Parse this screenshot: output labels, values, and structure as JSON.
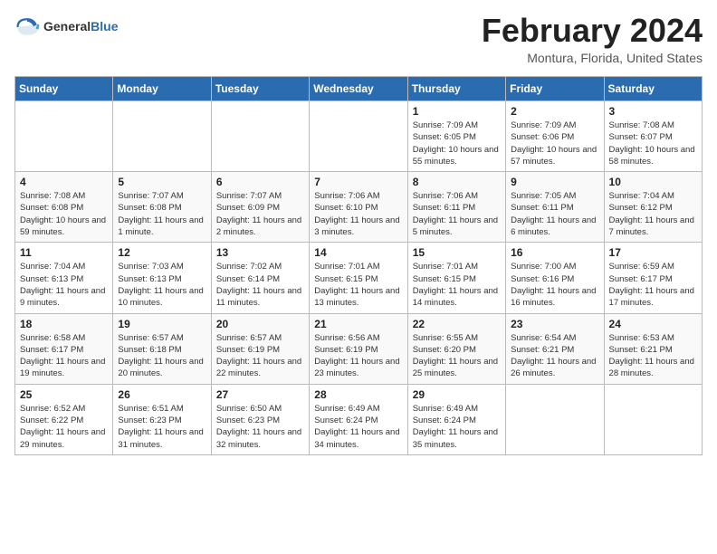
{
  "header": {
    "logo": {
      "general": "General",
      "blue": "Blue"
    },
    "title": "February 2024",
    "location": "Montura, Florida, United States"
  },
  "calendar": {
    "days_of_week": [
      "Sunday",
      "Monday",
      "Tuesday",
      "Wednesday",
      "Thursday",
      "Friday",
      "Saturday"
    ],
    "weeks": [
      [
        {
          "day": "",
          "info": ""
        },
        {
          "day": "",
          "info": ""
        },
        {
          "day": "",
          "info": ""
        },
        {
          "day": "",
          "info": ""
        },
        {
          "day": "1",
          "info": "Sunrise: 7:09 AM\nSunset: 6:05 PM\nDaylight: 10 hours\nand 55 minutes."
        },
        {
          "day": "2",
          "info": "Sunrise: 7:09 AM\nSunset: 6:06 PM\nDaylight: 10 hours\nand 57 minutes."
        },
        {
          "day": "3",
          "info": "Sunrise: 7:08 AM\nSunset: 6:07 PM\nDaylight: 10 hours\nand 58 minutes."
        }
      ],
      [
        {
          "day": "4",
          "info": "Sunrise: 7:08 AM\nSunset: 6:08 PM\nDaylight: 10 hours\nand 59 minutes."
        },
        {
          "day": "5",
          "info": "Sunrise: 7:07 AM\nSunset: 6:08 PM\nDaylight: 11 hours\nand 1 minute."
        },
        {
          "day": "6",
          "info": "Sunrise: 7:07 AM\nSunset: 6:09 PM\nDaylight: 11 hours\nand 2 minutes."
        },
        {
          "day": "7",
          "info": "Sunrise: 7:06 AM\nSunset: 6:10 PM\nDaylight: 11 hours\nand 3 minutes."
        },
        {
          "day": "8",
          "info": "Sunrise: 7:06 AM\nSunset: 6:11 PM\nDaylight: 11 hours\nand 5 minutes."
        },
        {
          "day": "9",
          "info": "Sunrise: 7:05 AM\nSunset: 6:11 PM\nDaylight: 11 hours\nand 6 minutes."
        },
        {
          "day": "10",
          "info": "Sunrise: 7:04 AM\nSunset: 6:12 PM\nDaylight: 11 hours\nand 7 minutes."
        }
      ],
      [
        {
          "day": "11",
          "info": "Sunrise: 7:04 AM\nSunset: 6:13 PM\nDaylight: 11 hours\nand 9 minutes."
        },
        {
          "day": "12",
          "info": "Sunrise: 7:03 AM\nSunset: 6:13 PM\nDaylight: 11 hours\nand 10 minutes."
        },
        {
          "day": "13",
          "info": "Sunrise: 7:02 AM\nSunset: 6:14 PM\nDaylight: 11 hours\nand 11 minutes."
        },
        {
          "day": "14",
          "info": "Sunrise: 7:01 AM\nSunset: 6:15 PM\nDaylight: 11 hours\nand 13 minutes."
        },
        {
          "day": "15",
          "info": "Sunrise: 7:01 AM\nSunset: 6:15 PM\nDaylight: 11 hours\nand 14 minutes."
        },
        {
          "day": "16",
          "info": "Sunrise: 7:00 AM\nSunset: 6:16 PM\nDaylight: 11 hours\nand 16 minutes."
        },
        {
          "day": "17",
          "info": "Sunrise: 6:59 AM\nSunset: 6:17 PM\nDaylight: 11 hours\nand 17 minutes."
        }
      ],
      [
        {
          "day": "18",
          "info": "Sunrise: 6:58 AM\nSunset: 6:17 PM\nDaylight: 11 hours\nand 19 minutes."
        },
        {
          "day": "19",
          "info": "Sunrise: 6:57 AM\nSunset: 6:18 PM\nDaylight: 11 hours\nand 20 minutes."
        },
        {
          "day": "20",
          "info": "Sunrise: 6:57 AM\nSunset: 6:19 PM\nDaylight: 11 hours\nand 22 minutes."
        },
        {
          "day": "21",
          "info": "Sunrise: 6:56 AM\nSunset: 6:19 PM\nDaylight: 11 hours\nand 23 minutes."
        },
        {
          "day": "22",
          "info": "Sunrise: 6:55 AM\nSunset: 6:20 PM\nDaylight: 11 hours\nand 25 minutes."
        },
        {
          "day": "23",
          "info": "Sunrise: 6:54 AM\nSunset: 6:21 PM\nDaylight: 11 hours\nand 26 minutes."
        },
        {
          "day": "24",
          "info": "Sunrise: 6:53 AM\nSunset: 6:21 PM\nDaylight: 11 hours\nand 28 minutes."
        }
      ],
      [
        {
          "day": "25",
          "info": "Sunrise: 6:52 AM\nSunset: 6:22 PM\nDaylight: 11 hours\nand 29 minutes."
        },
        {
          "day": "26",
          "info": "Sunrise: 6:51 AM\nSunset: 6:23 PM\nDaylight: 11 hours\nand 31 minutes."
        },
        {
          "day": "27",
          "info": "Sunrise: 6:50 AM\nSunset: 6:23 PM\nDaylight: 11 hours\nand 32 minutes."
        },
        {
          "day": "28",
          "info": "Sunrise: 6:49 AM\nSunset: 6:24 PM\nDaylight: 11 hours\nand 34 minutes."
        },
        {
          "day": "29",
          "info": "Sunrise: 6:49 AM\nSunset: 6:24 PM\nDaylight: 11 hours\nand 35 minutes."
        },
        {
          "day": "",
          "info": ""
        },
        {
          "day": "",
          "info": ""
        }
      ]
    ]
  }
}
